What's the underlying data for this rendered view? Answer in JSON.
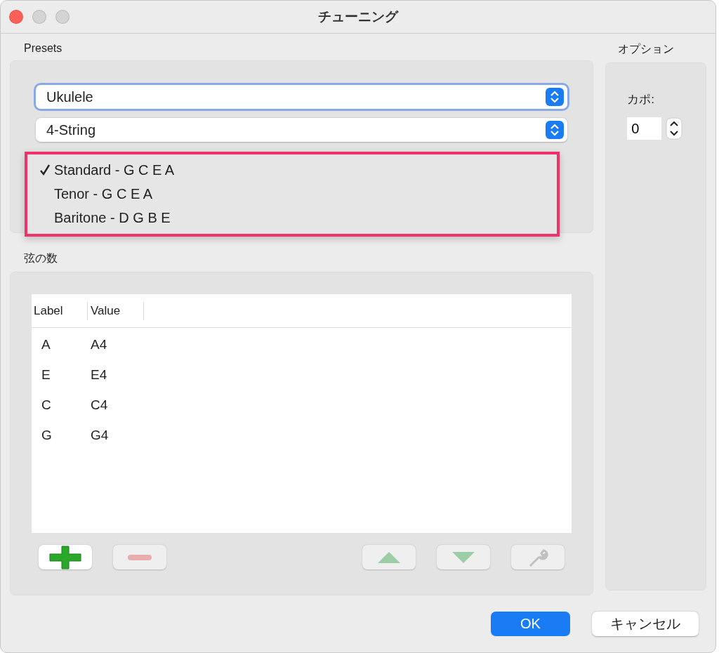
{
  "window": {
    "title": "チューニング"
  },
  "presets": {
    "label": "Presets",
    "instrument": "Ukulele",
    "strings": "4-String",
    "menu": [
      {
        "label": "Standard - G C E A",
        "selected": true
      },
      {
        "label": "Tenor - G C E A",
        "selected": false
      },
      {
        "label": "Baritone - D G B E",
        "selected": false
      }
    ]
  },
  "string_count": {
    "label": "弦の数",
    "columns": [
      "Label",
      "Value"
    ],
    "rows": [
      [
        "A",
        "A4"
      ],
      [
        "E",
        "E4"
      ],
      [
        "C",
        "C4"
      ],
      [
        "G",
        "G4"
      ]
    ],
    "tools": [
      {
        "kind": "add",
        "disabled": false
      },
      {
        "kind": "remove",
        "disabled": true
      },
      {
        "kind": "up",
        "disabled": true
      },
      {
        "kind": "down",
        "disabled": true
      },
      {
        "kind": "edit",
        "disabled": true
      }
    ]
  },
  "options": {
    "label": "オプション",
    "capo_label": "カポ:",
    "capo_value": "0"
  },
  "buttons": [
    {
      "label": "OK",
      "kind": "primary"
    },
    {
      "label": "キャンセル",
      "kind": "secondary"
    }
  ]
}
